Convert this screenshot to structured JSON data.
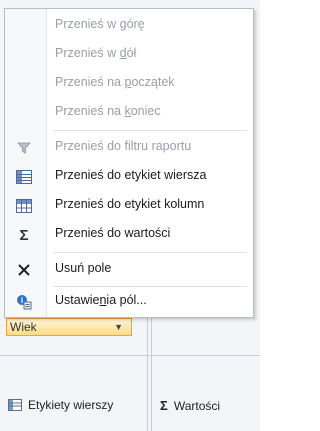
{
  "menu": {
    "items": [
      {
        "pre": "Przenieś w ",
        "ul": "g",
        "post": "órę",
        "disabled": true,
        "icon": ""
      },
      {
        "pre": "Przenieś w ",
        "ul": "d",
        "post": "ół",
        "disabled": true,
        "icon": ""
      },
      {
        "pre": "Przenieś na ",
        "ul": "p",
        "post": "oczątek",
        "disabled": true,
        "icon": ""
      },
      {
        "pre": "Przenieś na ",
        "ul": "k",
        "post": "oniec",
        "disabled": true,
        "icon": ""
      },
      {
        "pre": "Przenieś do filtru raportu",
        "ul": "",
        "post": "",
        "disabled": true,
        "icon": "filter-icon"
      },
      {
        "pre": "Przenieś do etykiet wiersza",
        "ul": "",
        "post": "",
        "disabled": false,
        "icon": "row-labels-icon"
      },
      {
        "pre": "Przenieś do etykiet kolumn",
        "ul": "",
        "post": "",
        "disabled": false,
        "icon": "column-labels-icon"
      },
      {
        "pre": "Przenieś do wartości",
        "ul": "",
        "post": "",
        "disabled": false,
        "icon": "sigma-icon"
      },
      {
        "pre": "Usuń pole",
        "ul": "",
        "post": "",
        "disabled": false,
        "icon": "remove-icon"
      },
      {
        "pre": "Ustawie",
        "ul": "n",
        "post": "ia pól...",
        "disabled": false,
        "icon": "field-settings-icon"
      }
    ]
  },
  "field_pill": {
    "label": "Wiek"
  },
  "areas": {
    "rows": "Etykiety wierszy",
    "values": "Wartości"
  },
  "colors": {
    "accent": "#f9dc86",
    "menu_border": "#b7bec9",
    "disabled_text": "#9aa0a8"
  }
}
